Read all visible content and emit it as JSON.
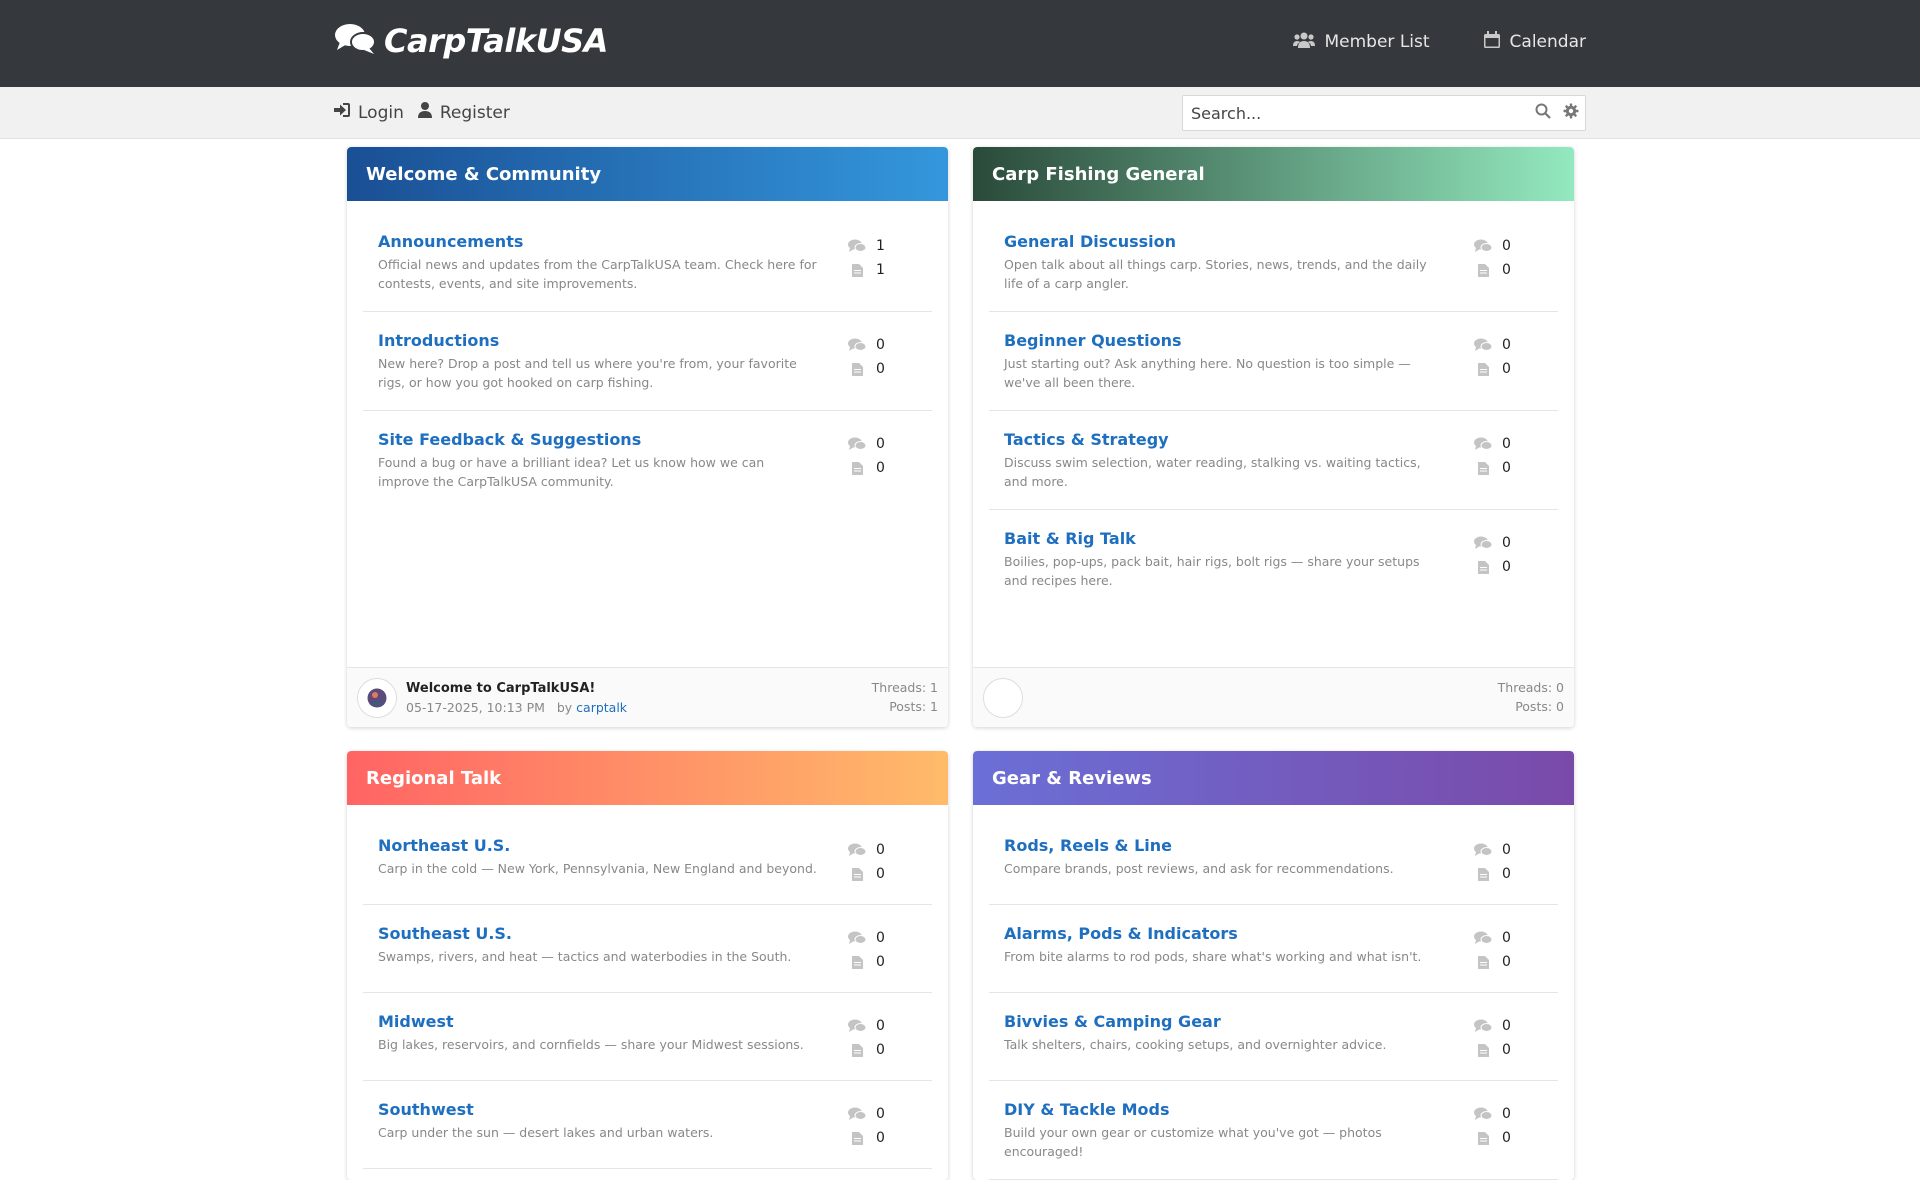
{
  "brand": {
    "name": "CarpTalkUSA",
    "icon": "comments-icon"
  },
  "topnav": [
    {
      "label": "Member List",
      "icon": "users-icon"
    },
    {
      "label": "Calendar",
      "icon": "calendar-icon"
    }
  ],
  "auth": {
    "login": "Login",
    "register": "Register"
  },
  "search": {
    "placeholder": "Search..."
  },
  "categories": [
    {
      "title": "Welcome & Community",
      "forums": [
        {
          "name": "Announcements",
          "desc": "Official news and updates from the CarpTalkUSA team. Check here for contests, events, and site improvements.",
          "threads": "1",
          "posts": "1"
        },
        {
          "name": "Introductions",
          "desc": "New here? Drop a post and tell us where you're from, your favorite rigs, or how you got hooked on carp fishing.",
          "threads": "0",
          "posts": "0"
        },
        {
          "name": "Site Feedback & Suggestions",
          "desc": "Found a bug or have a brilliant idea? Let us know how we can improve the CarpTalkUSA community.",
          "threads": "0",
          "posts": "0"
        }
      ],
      "footer": {
        "last_title": "Welcome to CarpTalkUSA!",
        "last_date": "05-17-2025, 10:13 PM",
        "by": "by",
        "author": "carptalk",
        "threads": "Threads: 1",
        "posts": "Posts: 1"
      }
    },
    {
      "title": "Carp Fishing General",
      "forums": [
        {
          "name": "General Discussion",
          "desc": "Open talk about all things carp. Stories, news, trends, and the daily life of a carp angler.",
          "threads": "0",
          "posts": "0"
        },
        {
          "name": "Beginner Questions",
          "desc": "Just starting out? Ask anything here. No question is too simple — we've all been there.",
          "threads": "0",
          "posts": "0"
        },
        {
          "name": "Tactics & Strategy",
          "desc": "Discuss swim selection, water reading, stalking vs. waiting tactics, and more.",
          "threads": "0",
          "posts": "0"
        },
        {
          "name": "Bait & Rig Talk",
          "desc": "Boilies, pop-ups, pack bait, hair rigs, bolt rigs — share your setups and recipes here.",
          "threads": "0",
          "posts": "0"
        }
      ],
      "footer": {
        "threads": "Threads: 0",
        "posts": "Posts: 0"
      }
    },
    {
      "title": "Regional Talk",
      "forums": [
        {
          "name": "Northeast U.S.",
          "desc": "Carp in the cold — New York, Pennsylvania, New England and beyond.",
          "threads": "0",
          "posts": "0"
        },
        {
          "name": "Southeast U.S.",
          "desc": "Swamps, rivers, and heat — tactics and waterbodies in the South.",
          "threads": "0",
          "posts": "0"
        },
        {
          "name": "Midwest",
          "desc": "Big lakes, reservoirs, and cornfields — share your Midwest sessions.",
          "threads": "0",
          "posts": "0"
        },
        {
          "name": "Southwest",
          "desc": "Carp under the sun — desert lakes and urban waters.",
          "threads": "0",
          "posts": "0"
        }
      ]
    },
    {
      "title": "Gear & Reviews",
      "forums": [
        {
          "name": "Rods, Reels & Line",
          "desc": "Compare brands, post reviews, and ask for recommendations.",
          "threads": "0",
          "posts": "0"
        },
        {
          "name": "Alarms, Pods & Indicators",
          "desc": "From bite alarms to rod pods, share what's working and what isn't.",
          "threads": "0",
          "posts": "0"
        },
        {
          "name": "Bivvies & Camping Gear",
          "desc": "Talk shelters, chairs, cooking setups, and overnighter advice.",
          "threads": "0",
          "posts": "0"
        },
        {
          "name": "DIY & Tackle Mods",
          "desc": "Build your own gear or customize what you've got — photos encouraged!",
          "threads": "0",
          "posts": "0"
        }
      ]
    }
  ],
  "colors": {
    "topbar": "#35393d",
    "link": "#1e6fc0"
  }
}
